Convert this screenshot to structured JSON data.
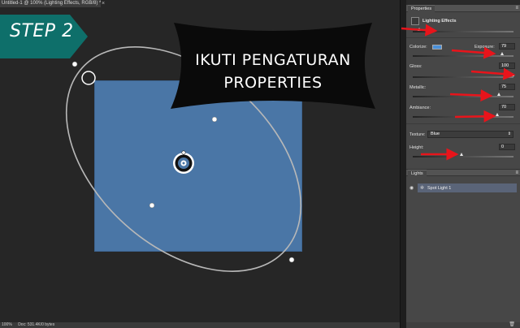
{
  "document": {
    "tab_title": "Untitled-1 @ 100% (Lighting Effects, RGB/8) *",
    "close_glyph": "×"
  },
  "annotations": {
    "step_label": "STEP 2",
    "callout_line1": "IKUTI PENGATURAN",
    "callout_line2": "PROPERTIES",
    "arrow_color": "#e8141b",
    "banner_color": "#0e6f6a"
  },
  "status_bar": {
    "zoom": "100%",
    "doc_size": "Doc: 531.4K/0 bytes"
  },
  "properties_panel": {
    "tab_label": "Properties",
    "menu_glyph": "≡",
    "filter_label": "Lighting Effects",
    "colorize_label": "Colorize:",
    "colorize_color": "#4a90d9",
    "exposure_label": "Exposure:",
    "exposure_value": "79",
    "gloss_label": "Gloss:",
    "gloss_value": "100",
    "metallic_label": "Metallic:",
    "metallic_value": "75",
    "ambiance_label": "Ambiance:",
    "ambiance_value": "70",
    "texture_label": "Texture:",
    "texture_value": "Blue",
    "height_label": "Height:",
    "height_value": "0"
  },
  "lights_panel": {
    "tab_label": "Lights",
    "menu_glyph": "≡",
    "items": [
      {
        "label": "Spot Light 1",
        "icon": "spotlight-icon",
        "visible_icon": "eye-icon"
      }
    ]
  }
}
